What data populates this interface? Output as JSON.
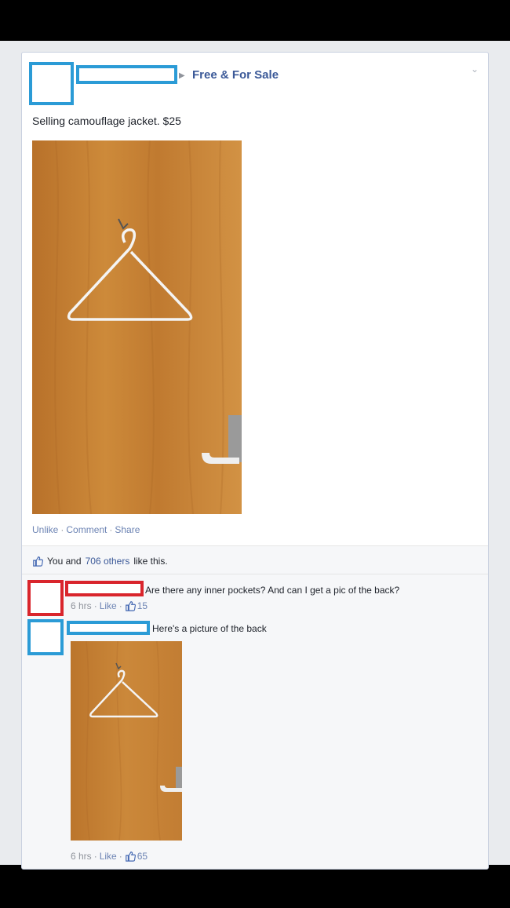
{
  "post": {
    "group_name": "Free & For Sale",
    "text": "Selling camouflage jacket. $25",
    "actions": {
      "unlike": "Unlike",
      "comment": "Comment",
      "share": "Share"
    },
    "likes": {
      "prefix": "You and",
      "count": "706 others",
      "suffix": "like this."
    }
  },
  "comments": [
    {
      "text": "Are there any inner pockets? And can I get a pic of the back?",
      "time": "6 hrs",
      "like_label": "Like",
      "likes": "15"
    },
    {
      "text": "Here's a picture of the back",
      "time": "6 hrs",
      "like_label": "Like",
      "likes": "65"
    }
  ],
  "colors": {
    "redaction_blue": "#2b9bd6",
    "redaction_red": "#d9252c",
    "link": "#3b5998",
    "door_wood": "#c47f2e"
  },
  "icons": {
    "thumbs_up": "thumbs-up-icon",
    "chevron": "chevron-down-icon",
    "hanger": "hanger-icon"
  }
}
